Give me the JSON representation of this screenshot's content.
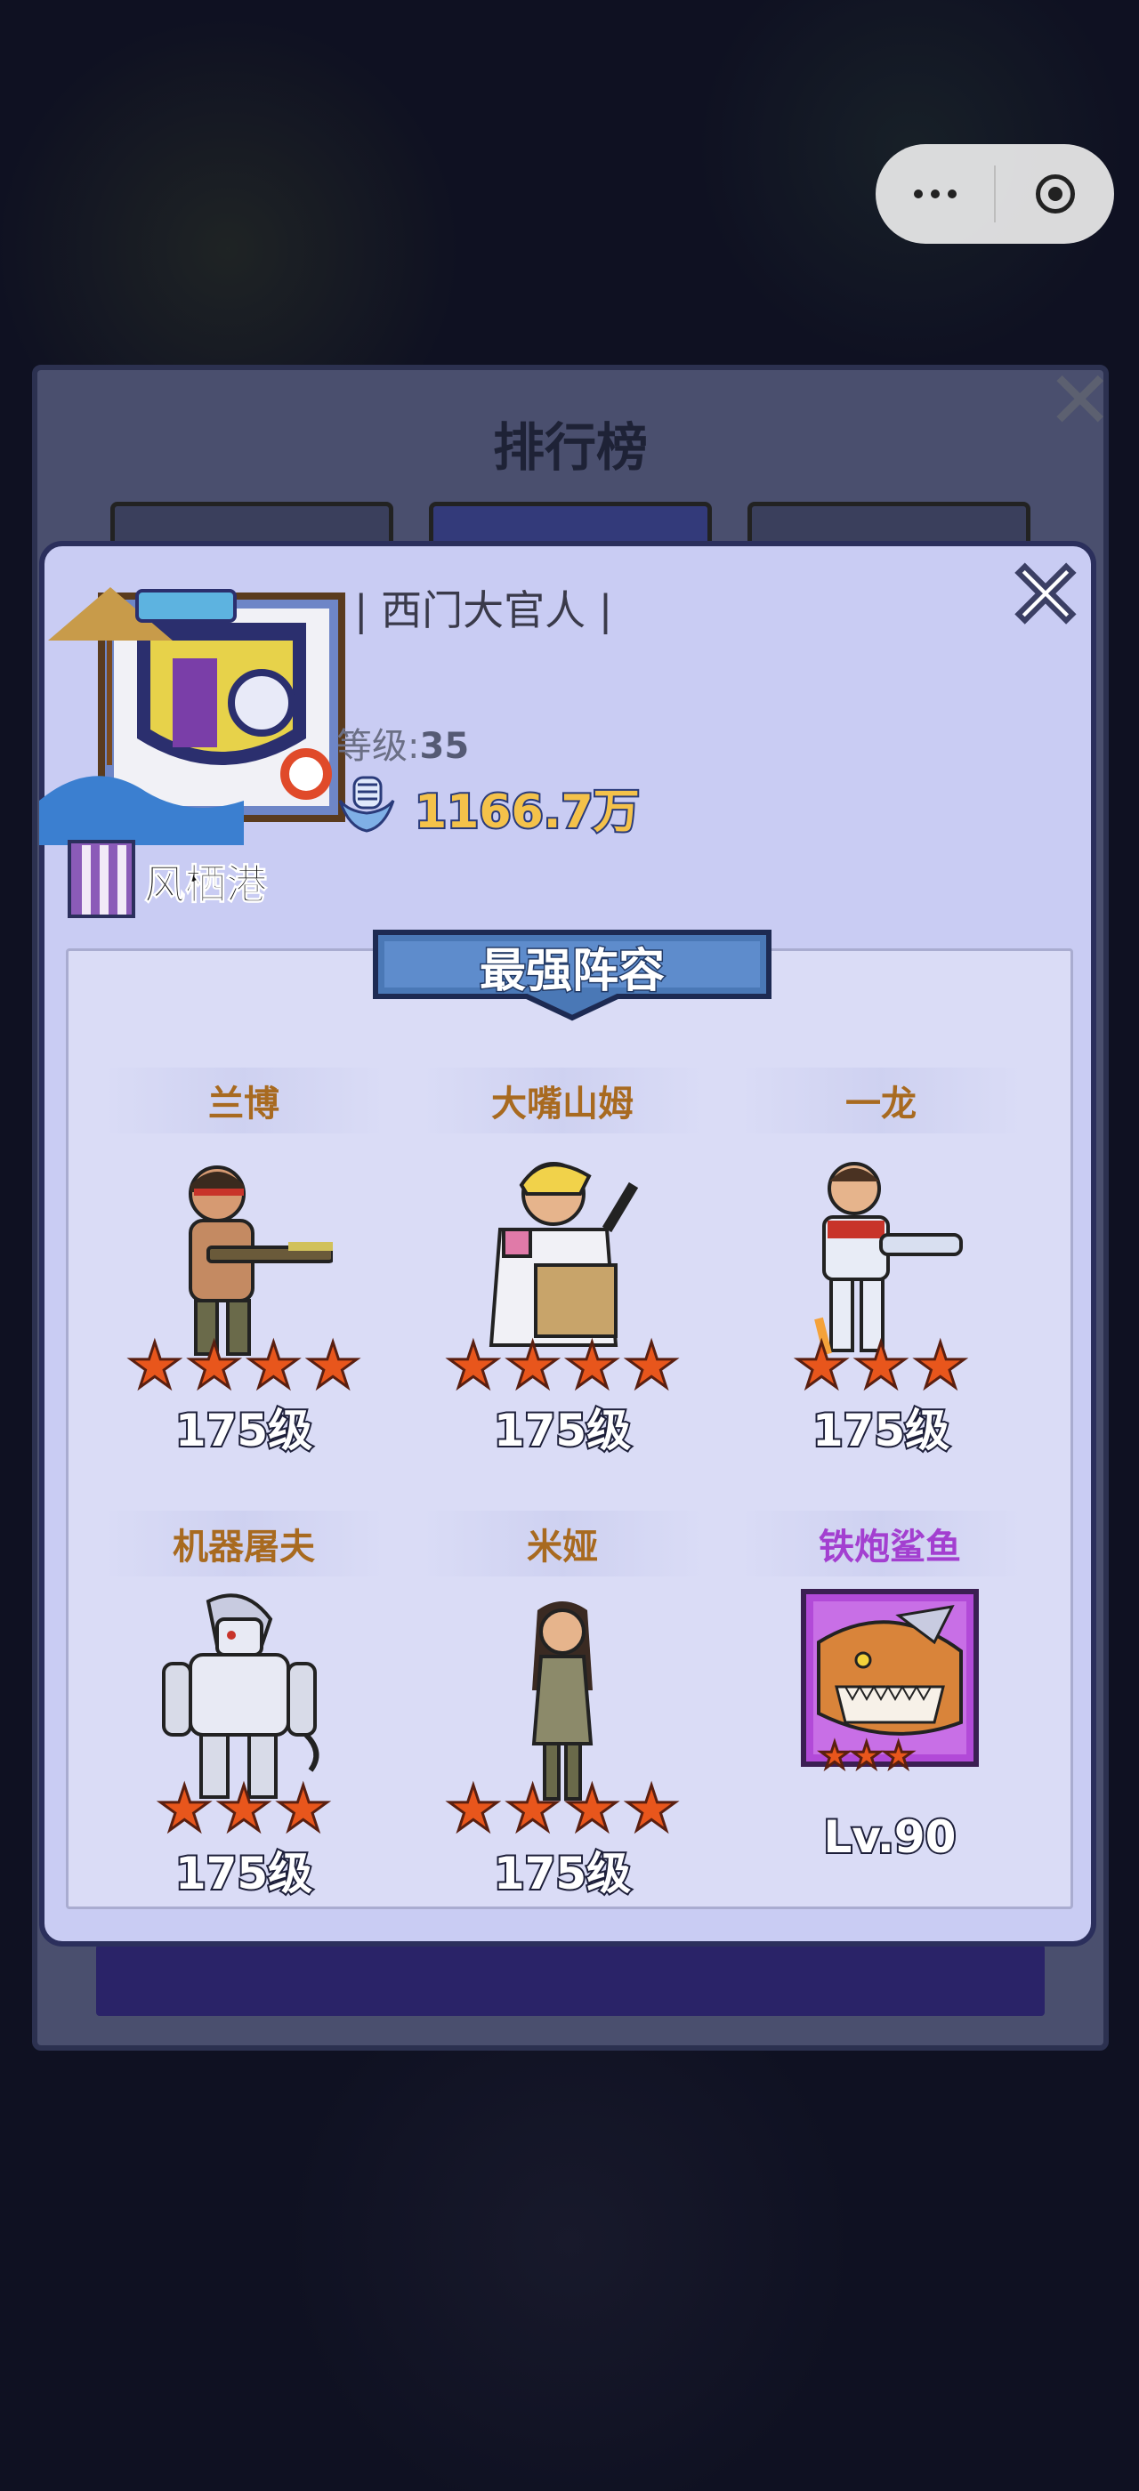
{
  "capsule": {
    "more_icon": "more-dots-icon",
    "close_icon": "target-icon"
  },
  "ranking": {
    "title": "排行榜"
  },
  "player": {
    "name": "| 西门大官人 |",
    "level_label": "等级:",
    "level_value": "35",
    "power": "1166.7万",
    "power_icon": "fist-power-icon",
    "guild": "风栖港"
  },
  "lineup": {
    "title": "最强阵容",
    "heroes": [
      {
        "name": "兰博",
        "stars": 4,
        "level": "175级"
      },
      {
        "name": "大嘴山姆",
        "stars": 4,
        "level": "175级"
      },
      {
        "name": "一龙",
        "stars": 3,
        "level": "175级"
      },
      {
        "name": "机器屠夫",
        "stars": 3,
        "level": "175级"
      },
      {
        "name": "米娅",
        "stars": 4,
        "level": "175级"
      },
      {
        "name": "铁炮鲨鱼",
        "stars": 3,
        "level": "Lv.90",
        "color": "#a33fd0"
      }
    ]
  },
  "colors": {
    "popup_bg": "#c9ccf3",
    "name_gold": "#a86a20",
    "name_purple": "#a33fd0",
    "power_gold": "#f4c24a",
    "star": "#e8561c"
  }
}
